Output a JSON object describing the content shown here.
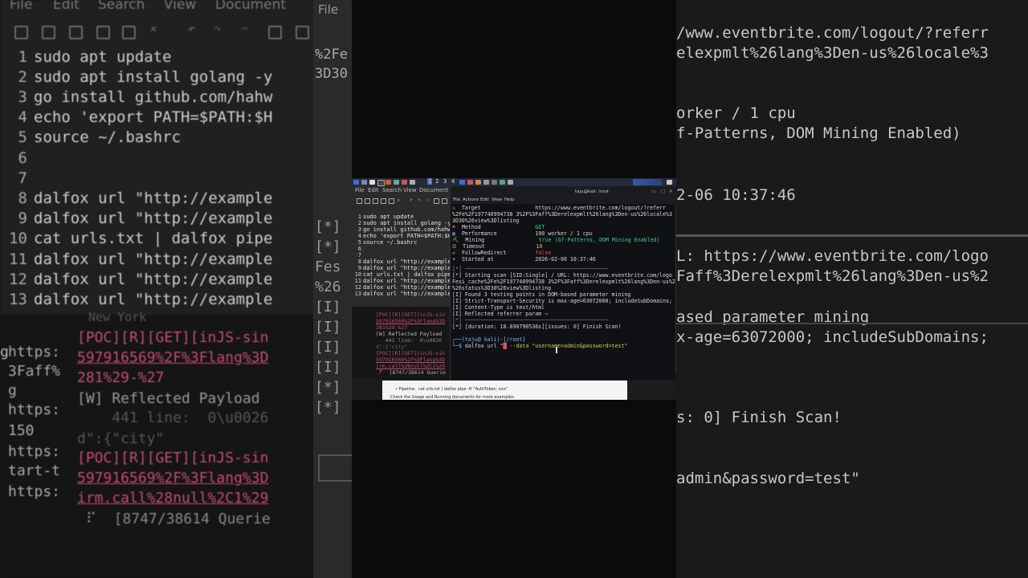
{
  "bg_left": {
    "menu": [
      "File",
      "Edit",
      "Search",
      "View",
      "Document"
    ],
    "code_lines": [
      {
        "n": "1",
        "text": "sudo apt update"
      },
      {
        "n": "2",
        "text": "sudo apt install golang -y"
      },
      {
        "n": "3",
        "text": "go install github.com/hahw"
      },
      {
        "n": "4",
        "text": "echo 'export PATH=$PATH:$H"
      },
      {
        "n": "5",
        "text": "source ~/.bashrc"
      },
      {
        "n": "6",
        "text": ""
      },
      {
        "n": "7",
        "text": ""
      },
      {
        "n": "8",
        "text": "dalfox url \"http://example"
      },
      {
        "n": "9",
        "text": "dalfox url \"http://example"
      },
      {
        "n": "10",
        "text": "cat urls.txt | dalfox pipe"
      },
      {
        "n": "11",
        "text": "dalfox url \"http://example"
      },
      {
        "n": "12",
        "text": "dalfox url \"http://example"
      },
      {
        "n": "13",
        "text": "dalfox url \"http://example"
      }
    ],
    "term_lines": [
      "New York",
      "[POC][R][GET][inJS-sin",
      "597916569%2F%3Flang%3D",
      "281%29-%27",
      "[W] Reflected Payload",
      "    441 line:  0\\u0026",
      "d\":{\"city\"",
      "[POC][R][GET][inJS-sin",
      "597916569%2F%3Flang%3D",
      "irm.call%28null%2C1%29",
      " ⠏  [8747/38614 Querie"
    ],
    "term_side": [
      "g",
      "https:",
      "3Faff%",
      "g",
      "https:",
      "150",
      "https:",
      "tart-t",
      "https:"
    ],
    "strip_file": "File",
    "strip_text": [
      "%2Fe",
      "3D30"
    ]
  },
  "bg_right": {
    "lines": [
      "/www.eventbrite.com/logout/?referr",
      "elexpmlt%26lang%3Den-us%26locale%3",
      "",
      "orker / 1 cpu",
      "f-Patterns, DOM Mining Enabled)",
      "",
      "2-06 10:37:46",
      "",
      "L: https://www.eventbrite.com/logo",
      "Faff%3Derelexpmlt%26lang%3Den-us%2",
      "",
      "ased parameter mining",
      "x-age=63072000; includeSubDomains;",
      "",
      "s: 0] Finish Scan!",
      "",
      "admin&password=test\""
    ],
    "left_marks": [
      "[*]",
      "[*]",
      "Fes",
      "%26",
      "[I]",
      "[I]",
      "[I]",
      "[I]",
      "[*]",
      "[*]"
    ]
  },
  "screen": {
    "taskbar": {
      "workspaces": [
        "1",
        "2",
        "3",
        "4"
      ],
      "title": "taju@kali: /root"
    },
    "editor": {
      "menu": [
        "File",
        "Edit",
        "Search",
        "View",
        "Document"
      ],
      "lines": [
        {
          "n": "1",
          "text": "sudo apt update"
        },
        {
          "n": "2",
          "text": "sudo apt install golang -y"
        },
        {
          "n": "3",
          "text": "go install github.com/hahw"
        },
        {
          "n": "4",
          "text": "echo 'export PATH=$PATH:$H"
        },
        {
          "n": "5",
          "text": "source ~/.bashrc"
        },
        {
          "n": "6",
          "text": ""
        },
        {
          "n": "7",
          "text": ""
        },
        {
          "n": "8",
          "text": "dalfox url \"http://example"
        },
        {
          "n": "9",
          "text": "dalfox url \"http://example"
        },
        {
          "n": "10",
          "text": "cat urls.txt | dalfox pipe"
        },
        {
          "n": "11",
          "text": "dalfox url \"http://example"
        },
        {
          "n": "12",
          "text": "dalfox url \"http://example"
        },
        {
          "n": "13",
          "text": "dalfox url \"http://example"
        }
      ],
      "term_lines": [
        "[POC][R][GET][inJS-sin",
        "597916569%2F%3Flang%3D",
        "281%29-%27",
        "[W] Reflected Payload",
        "   441 line:  0\\u0026",
        "d\":{\"city\"",
        "[POC][R][GET][inJS-sin",
        "597916569%2F%3Flang%3D",
        "irm.call%28null%2C1%29",
        " ⠏  [8747/38614 Querie"
      ]
    },
    "terminal": {
      "title": "taju@kali: /root",
      "menu": [
        "File",
        "Actions",
        "Edit",
        "View",
        "Help"
      ],
      "target_label": "Target",
      "target_value": "https://www.eventbrite.com/logout/?referr",
      "target_cont1": "%2Fe%2F197740994738 3%2F%3Faff%3Derelexpmlt%26lang%3Den-us%26locale%3",
      "target_cont2": "3D30%26view%3Dlisting",
      "rows": [
        {
          "label": "Method",
          "value": "GET"
        },
        {
          "label": "Performance",
          "value": "100 worker / 1 cpu"
        },
        {
          "label": "Mining",
          "value": "true (Gf-Patterns, DOM Mining Enabled)"
        },
        {
          "label": "Timeout",
          "value": "10"
        },
        {
          "label": "FollowRedirect",
          "value": "false"
        },
        {
          "label": "Started at",
          "value": "2026-02-06 10:37:46"
        }
      ],
      "scan_lines": [
        "[*] ─────────────────────────────────────────────",
        "[*] Starting scan [SID:Single] / URL: https://www.eventbrite.com/logo",
        "Fesi_cache%2Fe%2F197740994738 3%2F%3Faff%3Derelexpmlt%26lang%3Den-us%2",
        "%26status%3D30%26view%3Dlisting",
        "[I] Found 3 testing points in DOM-based parameter mining",
        "[I] Strict-Transport-Security is max-age=63072000; includeSubDomains;",
        "[I] Content-Type is text/html",
        "[I] Reflected referrer param ⇒",
        "[*] ─────────────────────────────────────────────",
        "[*] [duration: 18.690790536s][issues: 0] Finish Scan!"
      ],
      "prompt_user": "(taju@ kali)-[/root]",
      "prompt_cmd": "dalfox url \"",
      "prompt_data": "--data \"username=admin&password=test\""
    },
    "bottom_doc": {
      "line1": "• Pipeline:  cat urls.txt | dalfox pipe -H \"AuthToken: xxx\"",
      "line2": "Check the Usage and Running documents for more examples."
    }
  }
}
